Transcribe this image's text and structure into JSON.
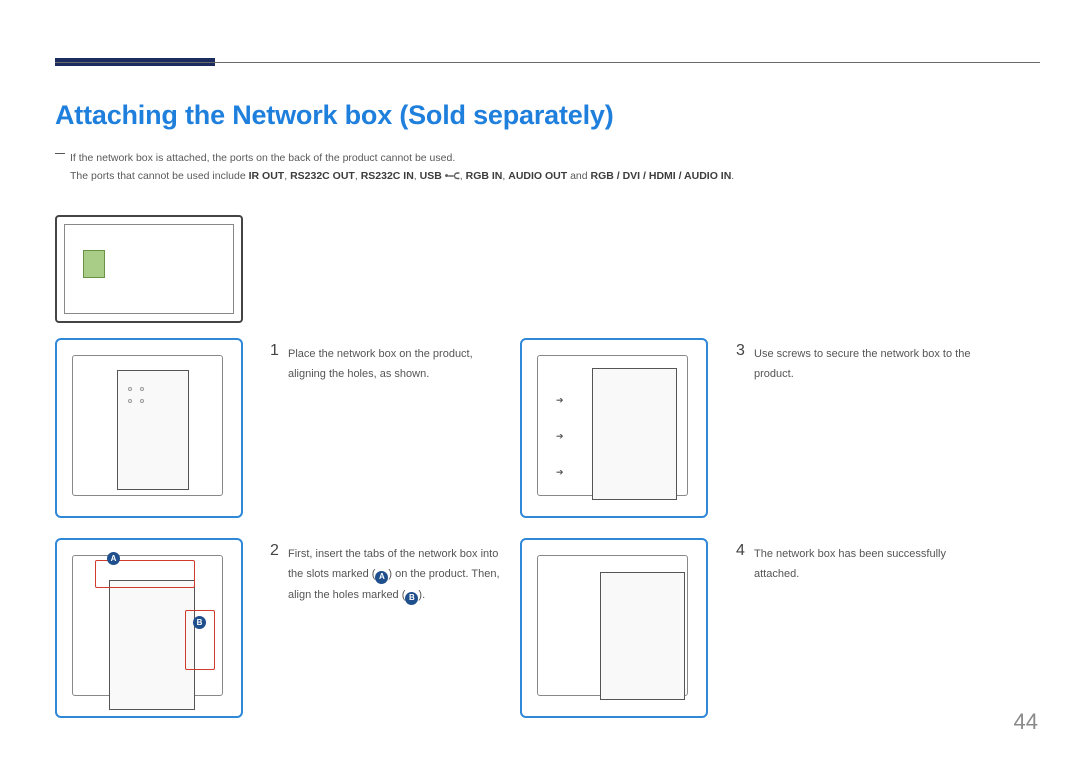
{
  "page": {
    "number": "44"
  },
  "heading": "Attaching the Network box (Sold separately)",
  "note": {
    "line1": "If the network box is attached, the ports on the back of the product cannot be used.",
    "line2_pre": "The ports that cannot be used include ",
    "ports": {
      "p1": "IR OUT",
      "p2": "RS232C OUT",
      "p3": "RS232C IN",
      "p4": "USB",
      "p5": "RGB IN",
      "p6": "AUDIO OUT",
      "p7": "RGB / DVI / HDMI / AUDIO IN"
    },
    "sep_comma": ", ",
    "sep_and": " and "
  },
  "badges": {
    "A": "A",
    "B": "B"
  },
  "steps": {
    "s1": {
      "num": "1",
      "text": "Place the network box on the product, aligning the holes, as shown."
    },
    "s2": {
      "num": "2",
      "part1": "First, insert the tabs of the network box into the slots marked (",
      "part2": ") on the product. Then, align the holes marked (",
      "part3": ")."
    },
    "s3": {
      "num": "3",
      "text": "Use screws to secure the network box to the product."
    },
    "s4": {
      "num": "4",
      "text": "The network box has been successfully attached."
    }
  },
  "icons": {
    "usb_glyph": "•⎯⊂"
  }
}
